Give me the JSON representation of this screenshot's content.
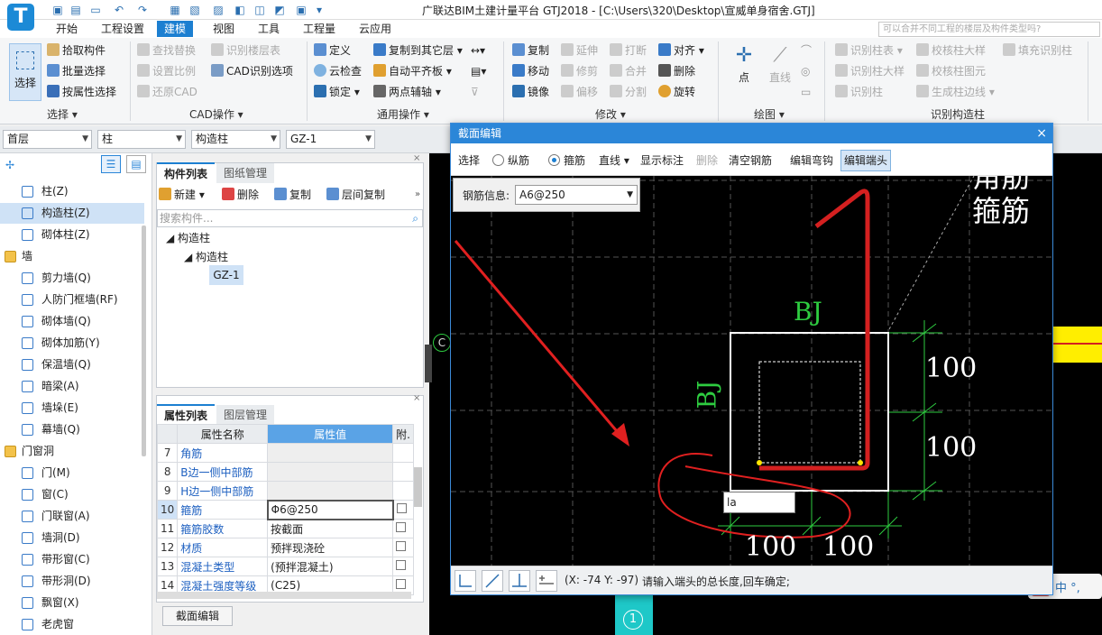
{
  "app": {
    "logo_letter": "T",
    "title": "广联达BIM土建计量平台 GTJ2018 - [C:\\Users\\320\\Desktop\\宣威单身宿舍.GTJ]",
    "search_placeholder": "可以合并不同工程的楼层及构件类型吗?"
  },
  "menu": [
    "开始",
    "工程设置",
    "建模",
    "视图",
    "工具",
    "工程量",
    "云应用"
  ],
  "menu_active": "建模",
  "ribbon": {
    "select_btn": "选择",
    "select_items": [
      "拾取构件",
      "批量选择",
      "按属性选择"
    ],
    "cad_items": [
      "查找替换",
      "设置比例",
      "还原CAD",
      "识别楼层表",
      "CAD识别选项"
    ],
    "general_items": [
      "定义",
      "云检查",
      "锁定",
      "复制到其它层",
      "自动平齐板",
      "两点辅轴"
    ],
    "modify_items": [
      "复制",
      "移动",
      "镜像",
      "延伸",
      "修剪",
      "偏移",
      "打断",
      "合并",
      "分割",
      "对齐",
      "删除",
      "旋转"
    ],
    "draw_items": [
      "点",
      "直线"
    ],
    "recog_items": [
      "识别柱表",
      "识别柱大样",
      "识别柱",
      "校核柱大样",
      "校核柱图元",
      "生成柱边线",
      "填充识别柱"
    ],
    "groups": [
      "选择",
      "CAD操作",
      "通用操作",
      "修改",
      "绘图",
      "识别构造柱"
    ]
  },
  "toolbar": {
    "floor": "首层",
    "category": "柱",
    "type": "构造柱",
    "component": "GZ-1"
  },
  "nav": {
    "items": [
      {
        "label": "柱(Z)",
        "cat": false
      },
      {
        "label": "构造柱(Z)",
        "cat": false,
        "selected": true
      },
      {
        "label": "砌体柱(Z)",
        "cat": false
      },
      {
        "label": "墙",
        "cat": true
      },
      {
        "label": "剪力墙(Q)",
        "cat": false
      },
      {
        "label": "人防门框墙(RF)",
        "cat": false
      },
      {
        "label": "砌体墙(Q)",
        "cat": false
      },
      {
        "label": "砌体加筋(Y)",
        "cat": false
      },
      {
        "label": "保温墙(Q)",
        "cat": false
      },
      {
        "label": "暗梁(A)",
        "cat": false
      },
      {
        "label": "墙垛(E)",
        "cat": false
      },
      {
        "label": "幕墙(Q)",
        "cat": false
      },
      {
        "label": "门窗洞",
        "cat": true
      },
      {
        "label": "门(M)",
        "cat": false
      },
      {
        "label": "窗(C)",
        "cat": false
      },
      {
        "label": "门联窗(A)",
        "cat": false
      },
      {
        "label": "墙洞(D)",
        "cat": false
      },
      {
        "label": "带形窗(C)",
        "cat": false
      },
      {
        "label": "带形洞(D)",
        "cat": false
      },
      {
        "label": "飘窗(X)",
        "cat": false
      },
      {
        "label": "老虎窗",
        "cat": false
      }
    ]
  },
  "components": {
    "tab_active": "构件列表",
    "tab_other": "图纸管理",
    "actions": [
      "新建",
      "删除",
      "复制",
      "层间复制"
    ],
    "search_placeholder": "搜索构件...",
    "tree_root": "构造柱",
    "tree_child": "构造柱",
    "tree_leaf": "GZ-1"
  },
  "properties": {
    "tab_active": "属性列表",
    "tab_other": "图层管理",
    "col_name": "属性名称",
    "col_value": "属性值",
    "col_attach": "附.",
    "rows": [
      {
        "num": "7",
        "name": "角筋",
        "value": ""
      },
      {
        "num": "8",
        "name": "B边一侧中部筋",
        "value": ""
      },
      {
        "num": "9",
        "name": "H边一侧中部筋",
        "value": ""
      },
      {
        "num": "10",
        "name": "箍筋",
        "value": "Φ6@250"
      },
      {
        "num": "11",
        "name": "箍筋胶数",
        "value": "按截面"
      },
      {
        "num": "12",
        "name": "材质",
        "value": "预拌现浇砼"
      },
      {
        "num": "13",
        "name": "混凝土类型",
        "value": "(预拌混凝土)"
      },
      {
        "num": "14",
        "name": "混凝土强度等级",
        "value": "(C25)"
      }
    ],
    "section_edit_btn": "截面编辑"
  },
  "dialog": {
    "title": "截面编辑",
    "tools": {
      "select": "选择",
      "radio_long": "纵筋",
      "radio_stirrup": "箍筋",
      "line": "直线",
      "show_label": "显示标注",
      "delete": "删除",
      "clear": "清空钢筋",
      "edit_hook": "编辑弯钩",
      "edit_end": "编辑端头"
    },
    "rebar_info_label": "钢筋信息:",
    "rebar_info_value": "A6@250",
    "labels": {
      "bj_top": "BJ",
      "bj_left": "BJ",
      "dim_right_1": "100",
      "dim_right_2": "100",
      "dim_bottom_1": "100",
      "dim_bottom_2": "100",
      "stirrup_text": "箍筋",
      "partial_top_text": "角筋"
    },
    "input_value": "la",
    "status_coords": "(X: -74 Y: -97)",
    "status_msg": "请输入端头的总长度,回车确定;"
  },
  "canvas": {
    "axis_c": "C",
    "axis_1": "1"
  },
  "ime": {
    "logo": "S",
    "text": "中 °,"
  },
  "colors": {
    "accent": "#1c7fd1",
    "rebar_red": "#d42020",
    "dim_green": "#2ecc40",
    "highlight_yellow": "#ffee00"
  }
}
